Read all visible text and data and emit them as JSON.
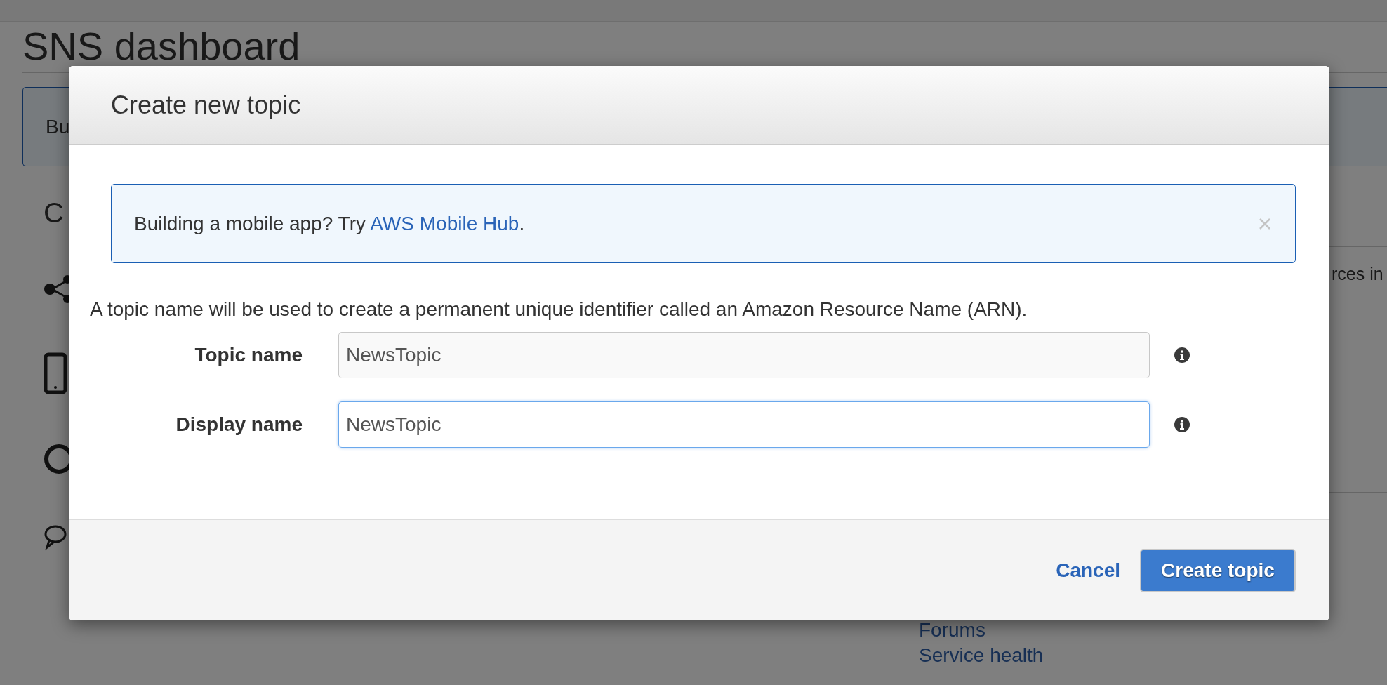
{
  "page": {
    "title": "SNS dashboard",
    "banner_text": "Bu",
    "section_heading": "C",
    "side_text": "rces in",
    "links": [
      "Forums",
      "Service health"
    ]
  },
  "dialog": {
    "title": "Create new topic",
    "notice": {
      "text": "Building a mobile app? Try ",
      "link": "AWS Mobile Hub",
      "suffix": "."
    },
    "description": "A topic name will be used to create a permanent unique identifier called an Amazon Resource Name (ARN).",
    "fields": [
      {
        "label": "Topic name",
        "value": "NewsTopic",
        "focused": false
      },
      {
        "label": "Display name",
        "value": "NewsTopic",
        "focused": true
      }
    ],
    "buttons": [
      {
        "label": "Cancel",
        "kind": "link"
      },
      {
        "label": "Create topic",
        "kind": "primary"
      }
    ]
  }
}
